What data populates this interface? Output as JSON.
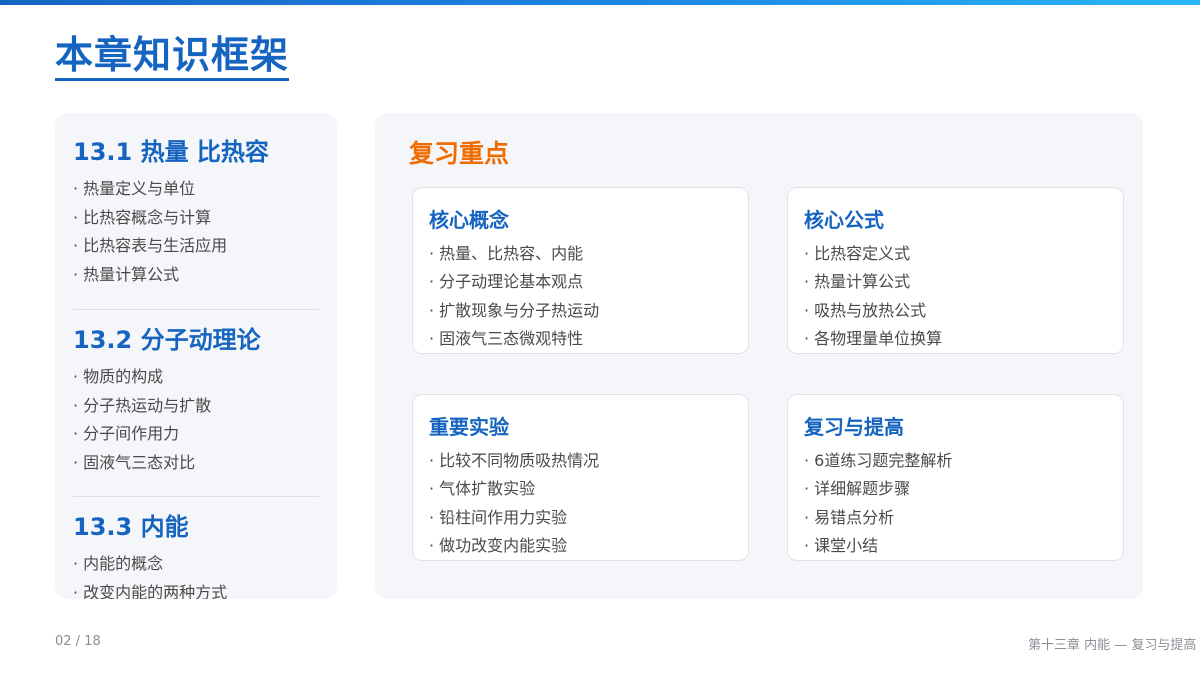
{
  "header": {
    "title": "本章知识框架"
  },
  "left_panel": {
    "sections": [
      {
        "title": "13.1 热量 比热容",
        "items": [
          "· 热量定义与单位",
          "· 比热容概念与计算",
          "· 比热容表与生活应用",
          "· 热量计算公式"
        ]
      },
      {
        "title": "13.2 分子动理论",
        "items": [
          "· 物质的构成",
          "· 分子热运动与扩散",
          "· 分子间作用力",
          "· 固液气三态对比"
        ]
      },
      {
        "title": "13.3 内能",
        "items": [
          "· 内能的概念",
          "· 改变内能的两种方式"
        ]
      }
    ]
  },
  "right_panel": {
    "heading": "复习重点",
    "cards": [
      {
        "title": "核心概念",
        "items": [
          "· 热量、比热容、内能",
          "· 分子动理论基本观点",
          "· 扩散现象与分子热运动",
          "· 固液气三态微观特性"
        ]
      },
      {
        "title": "核心公式",
        "items": [
          "· 比热容定义式",
          "· 热量计算公式",
          "· 吸热与放热公式",
          "· 各物理量单位换算"
        ]
      },
      {
        "title": "重要实验",
        "items": [
          "· 比较不同物质吸热情况",
          "· 气体扩散实验",
          "· 铅柱间作用力实验",
          "· 做功改变内能实验"
        ]
      },
      {
        "title": "复习与提高",
        "items": [
          "· 6道练习题完整解析",
          "· 详细解题步骤",
          "· 易错点分析",
          "· 课堂小结"
        ]
      }
    ]
  },
  "footer": {
    "page": "02 / 18",
    "chapter": "第十三章 内能 — 复习与提高"
  },
  "colors": {
    "primary": "#1565c0",
    "accent": "#ef6c00",
    "panel_bg": "#f4f6f9"
  }
}
